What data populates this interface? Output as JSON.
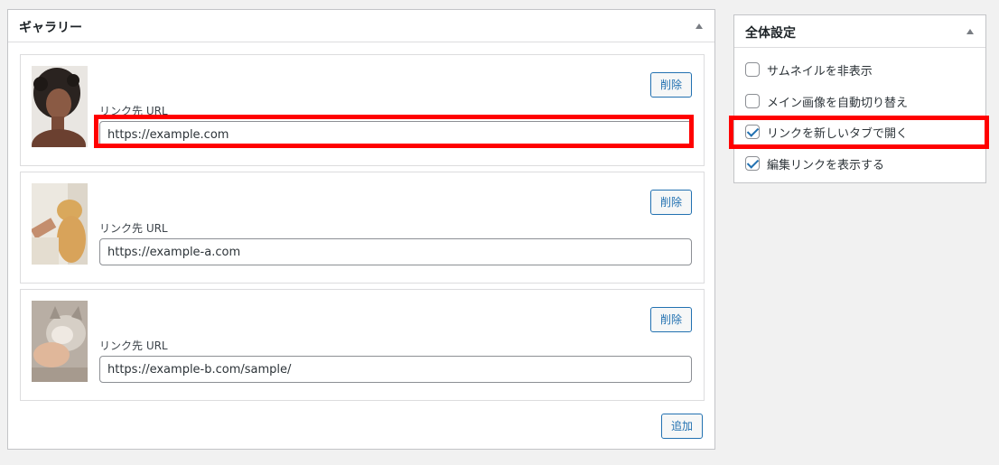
{
  "gallery": {
    "title": "ギャラリー",
    "items": [
      {
        "thumb_icon": "woman-portrait-thumbnail",
        "link_label": "リンク先 URL",
        "url": "https://example.com",
        "delete_label": "削除"
      },
      {
        "thumb_icon": "dog-high-five-thumbnail",
        "link_label": "リンク先 URL",
        "url": "https://example-a.com",
        "delete_label": "削除"
      },
      {
        "thumb_icon": "cat-thumbnail",
        "link_label": "リンク先 URL",
        "url": "https://example-b.com/sample/",
        "delete_label": "削除"
      }
    ],
    "add_label": "追加"
  },
  "settings": {
    "title": "全体設定",
    "options": [
      {
        "label": "サムネイルを非表示",
        "checked": false
      },
      {
        "label": "メイン画像を自動切り替え",
        "checked": false
      },
      {
        "label": "リンクを新しいタブで開く",
        "checked": true
      },
      {
        "label": "編集リンクを表示する",
        "checked": true
      }
    ]
  },
  "colors": {
    "accent": "#2271b1",
    "highlight": "#ff0000",
    "background": "#f1f1f1"
  }
}
